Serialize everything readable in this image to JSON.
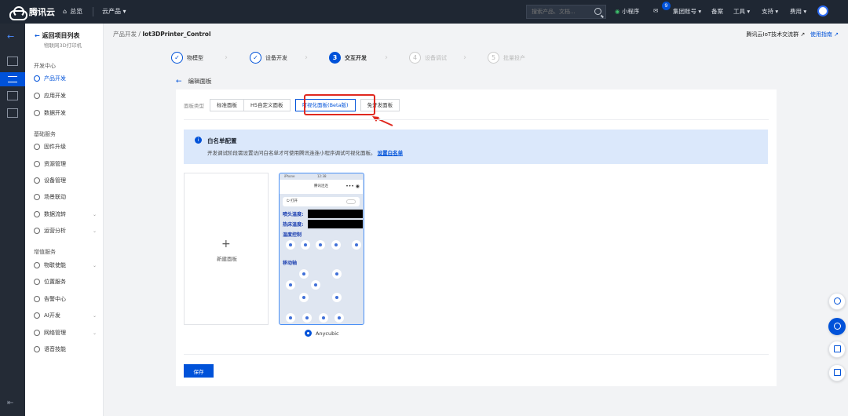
{
  "topbar": {
    "logo": "腾讯云",
    "home": "总览",
    "products": "云产品",
    "search_placeholder": "搜索产品、文档...",
    "miniprogram": "小程序",
    "message_count": "9",
    "account": "集团账号",
    "filing": "备案",
    "tools": "工具",
    "support": "支持",
    "fees": "费用"
  },
  "sidebar": {
    "back": "返回项目列表",
    "project": "物联网3D打印机",
    "group1": "开发中心",
    "items1": [
      "产品开发",
      "应用开发",
      "数据开发"
    ],
    "group2": "基础服务",
    "items2": [
      "固件升级",
      "资源管理",
      "设备管理",
      "场景联动",
      "数据流转",
      "运营分析"
    ],
    "group3": "增值服务",
    "items3": [
      "物联使能",
      "位置服务",
      "告警中心",
      "AI开发",
      "网络管理",
      "语音技能"
    ]
  },
  "breadcrumb": {
    "parent": "产品开发",
    "sep": "/",
    "current": "Iot3DPrinter_Control"
  },
  "toplinks": {
    "community": "腾讯云IoT技术交流群",
    "guide": "使用指南"
  },
  "steps": [
    {
      "num": "1",
      "label": "物模型",
      "state": "done"
    },
    {
      "num": "2",
      "label": "设备开发",
      "state": "done"
    },
    {
      "num": "3",
      "label": "交互开发",
      "state": "current"
    },
    {
      "num": "4",
      "label": "设备调试",
      "state": "todo"
    },
    {
      "num": "5",
      "label": "批量投产",
      "state": "todo"
    }
  ],
  "page": {
    "title": "编辑面板",
    "panel_type_label": "面板类型",
    "tabs": [
      "标准面板",
      "H5自定义面板",
      "可视化面板(Beta版)",
      "免开发面板"
    ],
    "selected_tab": "可视化面板(Beta版)",
    "notice_title": "白名单配置",
    "notice_desc": "开发调试阶段需设置访问白名单才可使用腾讯连连小程序调试可视化面板。",
    "notice_link": "设置白名单",
    "new_panel": "新建面板",
    "panel_name": "Anycubic",
    "save": "保存"
  },
  "phone": {
    "status_left": "iPhone",
    "status_time": "12:38",
    "nav_title": "腾讯连连",
    "power_label": "打开",
    "nozzle_temp": "喷头温度:",
    "bed_temp": "热床温度:",
    "temp_control": "温度控制",
    "move_axis": "移动轴",
    "temp_btn_labels": [
      "PLA预热",
      "ABS预热",
      "降温",
      "调平",
      "打印"
    ]
  },
  "colors": {
    "accent": "#0052d9",
    "topbar": "#1f2733",
    "highlight": "#e0281f"
  }
}
